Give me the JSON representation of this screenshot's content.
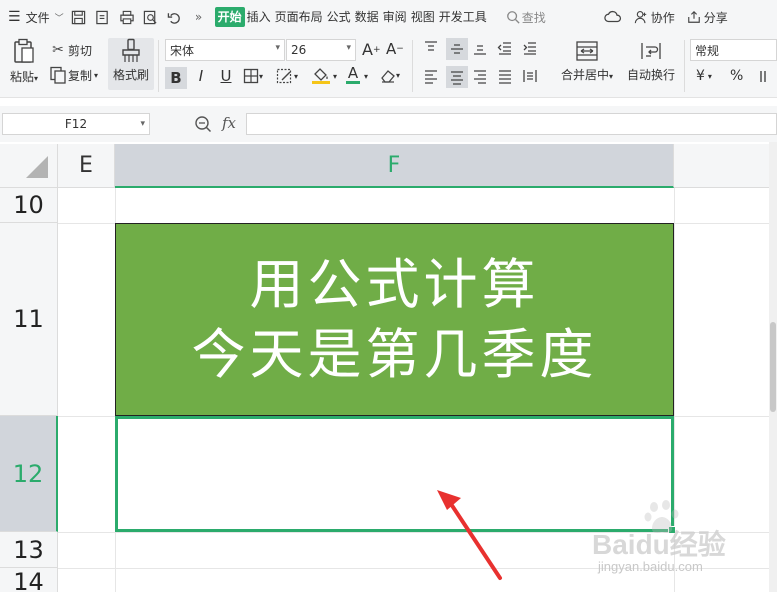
{
  "menu": {
    "file_label": "文件",
    "tabs": [
      "开始",
      "插入",
      "页面布局",
      "公式",
      "数据",
      "审阅",
      "视图",
      "开发工具"
    ],
    "search_label": "查找",
    "collab_label": "协作",
    "share_label": "分享"
  },
  "ribbon": {
    "paste_label": "粘贴",
    "cut_label": "剪切",
    "copy_label": "复制",
    "format_painter_label": "格式刷",
    "font_name": "宋体",
    "font_size": "26",
    "merge_label": "合并居中",
    "wrap_label": "自动换行",
    "number_format": "常规",
    "currency_symbol": "¥",
    "percent_symbol": "%"
  },
  "formula_bar": {
    "cell_ref": "F12",
    "fx_label": "fx",
    "formula": ""
  },
  "grid": {
    "col_e": "E",
    "col_f": "F",
    "rows": [
      "10",
      "11",
      "12",
      "13",
      "14"
    ],
    "title_line1": "用公式计算",
    "title_line2": "今天是第几季度"
  },
  "watermark": {
    "brand": "Baidu经验",
    "url": "jingyan.baidu.com"
  },
  "colors": {
    "accent": "#2bab6c",
    "cell_fill": "#70ad47",
    "arrow": "#e8312f"
  }
}
